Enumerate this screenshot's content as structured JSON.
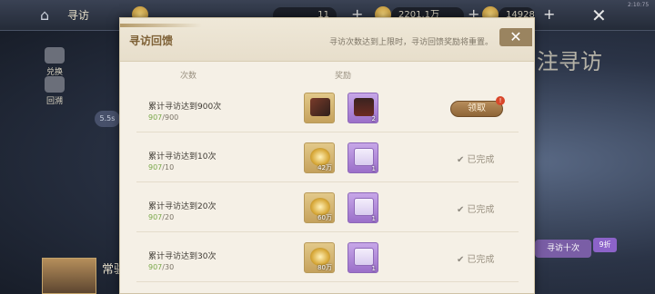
{
  "background": {
    "screen_title": "寻访",
    "resource_1": "11",
    "resource_2": "2201.1万",
    "resource_3": "14928",
    "side_menu": [
      {
        "label": "兑换"
      },
      {
        "label": "回溯"
      }
    ],
    "banner_text": "注寻访",
    "chip_label": "寻访十次",
    "chip_badge": "9折",
    "portrait_label": "常驻寻",
    "pill_label": "5.5s",
    "clock": "2:10:75"
  },
  "dialog": {
    "title": "寻访回馈",
    "subtitle": "寻访次数达到上限时，寻访回馈奖励将重置。",
    "close_icon": "close-x-icon",
    "col_count": "次数",
    "col_reward": "奖励",
    "rows": [
      {
        "name": "累计寻访达到900次",
        "current": "907",
        "target": "/900",
        "reward_1": {
          "icon": "book-bundle-icon",
          "count": ""
        },
        "reward_2": {
          "icon": "card-item-icon",
          "count": "2"
        },
        "status": "claim",
        "claim_label": "领取",
        "badge": "!"
      },
      {
        "name": "累计寻访达到10次",
        "current": "907",
        "target": "/10",
        "reward_1": {
          "icon": "gold-coin-icon",
          "count": "42万"
        },
        "reward_2": {
          "icon": "letter-icon",
          "count": "1"
        },
        "status": "done",
        "done_label": "已完成"
      },
      {
        "name": "累计寻访达到20次",
        "current": "907",
        "target": "/20",
        "reward_1": {
          "icon": "gold-coin-icon",
          "count": "60万"
        },
        "reward_2": {
          "icon": "letter-icon",
          "count": "1"
        },
        "status": "done",
        "done_label": "已完成"
      },
      {
        "name": "累计寻访达到30次",
        "current": "907",
        "target": "/30",
        "reward_1": {
          "icon": "gold-coin-icon",
          "count": "80万"
        },
        "reward_2": {
          "icon": "letter-icon",
          "count": "1"
        },
        "status": "done",
        "done_label": "已完成"
      }
    ]
  },
  "colors": {
    "dialog_bg": "#f5f0e6",
    "title": "#7f6237",
    "progress_current": "#7aa84a",
    "claim_button": "#a27a48",
    "reward_gold": "#c5a15c",
    "reward_purple": "#9b6fc9"
  }
}
